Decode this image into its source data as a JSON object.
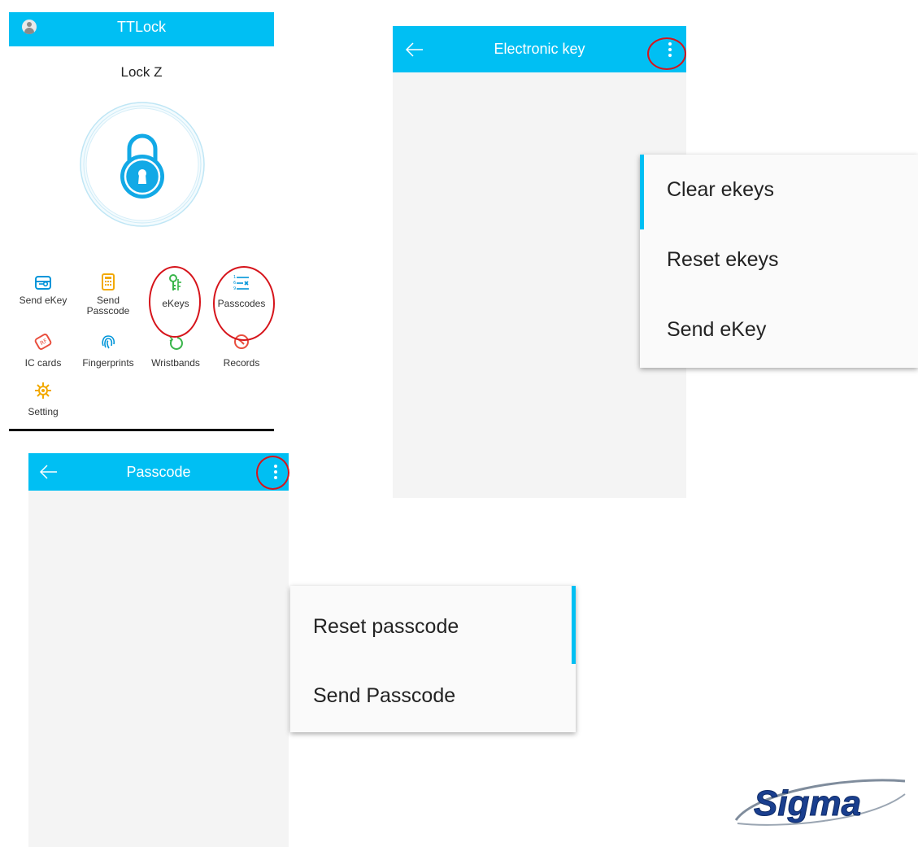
{
  "main_screen": {
    "title": "TTLock",
    "lock_name": "Lock Z",
    "menu": [
      {
        "label": "Send eKey",
        "icon": "send-ekey-icon",
        "color": "#0095d9"
      },
      {
        "label": "Send\nPasscode",
        "icon": "calculator-icon",
        "color": "#f2a900"
      },
      {
        "label": "eKeys",
        "icon": "keys-icon",
        "color": "#39b54a"
      },
      {
        "label": "Passcodes",
        "icon": "passcode-list-icon",
        "color": "#0095d9"
      },
      {
        "label": "IC cards",
        "icon": "rf-card-icon",
        "color": "#e94e3d"
      },
      {
        "label": "Fingerprints",
        "icon": "fingerprint-icon",
        "color": "#0095d9"
      },
      {
        "label": "Wristbands",
        "icon": "wristband-icon",
        "color": "#39b54a"
      },
      {
        "label": "Records",
        "icon": "records-clock-icon",
        "color": "#e94e3d"
      },
      {
        "label": "Setting",
        "icon": "gear-icon",
        "color": "#f2a900"
      }
    ]
  },
  "ekey_screen": {
    "title": "Electronic key",
    "menu": [
      "Clear ekeys",
      "Reset ekeys",
      "Send eKey"
    ]
  },
  "passcode_screen": {
    "title": "Passcode",
    "menu": [
      "Reset passcode",
      "Send Passcode"
    ]
  },
  "colors": {
    "header": "#00bff3",
    "annotation": "#d6141b",
    "logo_blue": "#1a3f8f"
  },
  "logo": {
    "text": "Sigma"
  }
}
